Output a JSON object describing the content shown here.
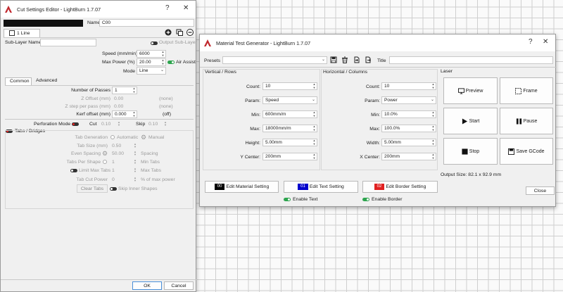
{
  "colors": {
    "accent": "#2da44e",
    "logo": "#c0282d",
    "swatch_black": "#000000",
    "swatch_blue": "#0000cc",
    "swatch_red": "#e02020"
  },
  "cut_settings": {
    "title": "Cut Settings Editor - LightBurn 1.7.07",
    "help_glyph": "?",
    "close_glyph": "✕",
    "name_label": "Name",
    "name_value": "C00",
    "sublayer_tab": "1 Line",
    "sublayer_name_label": "Sub-Layer Name",
    "output_sublayer_label": "Output Sub-Layer",
    "speed_label": "Speed (mm/min)",
    "speed_value": "6000",
    "maxpower_label": "Max Power (%)",
    "maxpower_value": "20.00",
    "air_assist_label": "Air Assist",
    "mode_label": "Mode",
    "mode_value": "Line",
    "tabs": [
      "Common",
      "Advanced"
    ],
    "passes_label": "Number of Passes",
    "passes_value": "1",
    "zoffset_label": "Z Offset (mm)",
    "zoffset_value": "0.00",
    "zoffset_note": "(none)",
    "zstep_label": "Z step per pass (mm)",
    "zstep_value": "0.00",
    "zstep_note": "(none)",
    "kerf_label": "Kerf offset (mm)",
    "kerf_value": "0.000",
    "kerf_note": "(off)",
    "perf_label": "Perforation Mode",
    "cut_label": "Cut",
    "cut_value": "0.10",
    "skip_label": "Skip",
    "skip_value": "0.10",
    "tabs_bridges_label": "Tabs / Bridges",
    "tab_gen_label": "Tab Generation",
    "automatic_label": "Automatic",
    "manual_label": "Manual",
    "tab_size_label": "Tab Size (mm)",
    "tab_size_value": "0.50",
    "even_spacing_label": "Even Spacing",
    "even_spacing_value": "50.00",
    "spacing_label": "Spacing",
    "tabs_per_shape_label": "Tabs Per Shape",
    "tabs_per_shape_value": "1",
    "min_tabs_label": "Min Tabs",
    "limit_max_label": "Limit Max Tabs",
    "limit_max_value": "1",
    "max_tabs_label": "Max Tabs",
    "tab_cut_power_label": "Tab Cut Power",
    "tab_cut_power_value": "0",
    "pct_max_power_label": "% of max power",
    "clear_tabs_label": "Clear Tabs",
    "skip_inner_label": "Skip Inner Shapes",
    "ok_label": "OK",
    "cancel_label": "Cancel"
  },
  "material_test": {
    "title": "Material Test Generator - LightBurn 1.7.07",
    "help_glyph": "?",
    "close_glyph": "✕",
    "presets_label": "Presets",
    "presets_value": "",
    "title_label": "Title",
    "title_value": "",
    "vertical_heading": "Vertical / Rows",
    "horizontal_heading": "Horizontal / Columns",
    "laser_heading": "Laser",
    "rows": {
      "count_label": "Count:",
      "count": "10",
      "param_label": "Param:",
      "param": "Speed",
      "min_label": "Min:",
      "min": "600mm/m",
      "max_label": "Max:",
      "max": "18000mm/m",
      "height_label": "Height:",
      "height": "5.00mm",
      "center_label": "Y Center:",
      "center": "200mm"
    },
    "cols": {
      "count_label": "Count:",
      "count": "10",
      "param_label": "Param:",
      "param": "Power",
      "min_label": "Min:",
      "min": "10.0%",
      "max_label": "Max:",
      "max": "100.0%",
      "width_label": "Width:",
      "width": "5.00mm",
      "center_label": "X Center:",
      "center": "200mm"
    },
    "laser_buttons": [
      "Preview",
      "Frame",
      "Start",
      "Pause",
      "Stop",
      "Save GCode"
    ],
    "output_size": "Output Size: 82.1 x 92.9 mm",
    "edit_material_swatch": "00",
    "edit_material_label": "Edit Material Setting",
    "edit_text_swatch": "01",
    "edit_text_label": "Edit Text Setting",
    "edit_border_swatch": "02",
    "edit_border_label": "Edit Border Setting",
    "enable_text_label": "Enable Text",
    "enable_border_label": "Enable Border",
    "close_label": "Close"
  }
}
